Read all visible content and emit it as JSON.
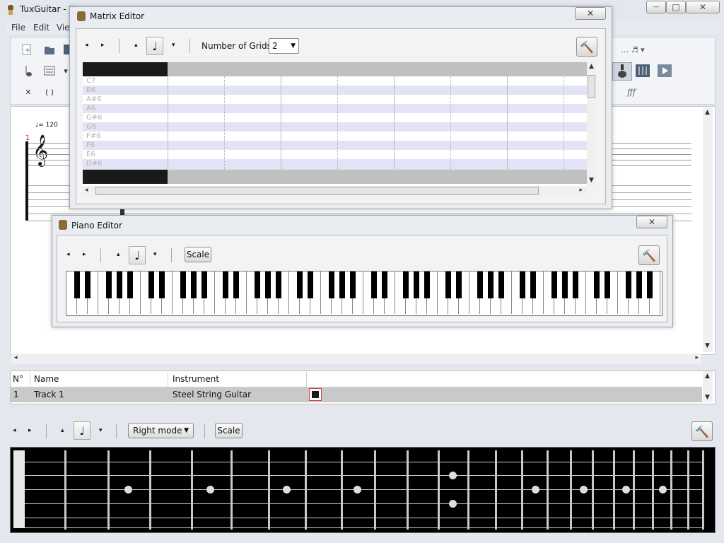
{
  "app": {
    "title": "TuxGuitar - U",
    "menu": [
      "File",
      "Edit",
      "Vie"
    ]
  },
  "matrix_editor": {
    "title": "Matrix Editor",
    "grids_label": "Number of Grids",
    "grids_value": "2",
    "close_label": "✕",
    "notes": [
      "C7",
      "B6",
      "A#6",
      "A6",
      "G#6",
      "G6",
      "F#6",
      "F6",
      "E6",
      "D#6"
    ]
  },
  "piano_editor": {
    "title": "Piano Editor",
    "scale_label": "Scale",
    "close_label": "✕"
  },
  "score": {
    "measure_number": "1",
    "tempo": "= 120"
  },
  "tracks": {
    "headers": [
      "N°",
      "Name",
      "Instrument"
    ],
    "rows": [
      {
        "number": "1",
        "name": "Track 1",
        "instrument": "Steel String Guitar"
      }
    ]
  },
  "fretboard": {
    "mode": "Right mode",
    "scale_label": "Scale"
  },
  "window_controls": {
    "minimize": "—",
    "maximize": "□",
    "close": "✕"
  },
  "colors": {
    "dialog_bg": "#e9ecf1",
    "fretboard_bg": "#000000",
    "matrix_header": "#1a1a1a",
    "matrix_stripe": "#e2e3f5",
    "track_color": "#1a1a1a",
    "track_color_border": "#d04040"
  }
}
